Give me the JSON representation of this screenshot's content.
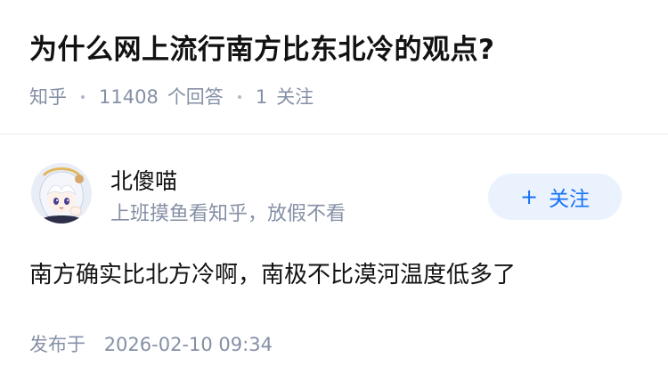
{
  "question": {
    "title": "为什么网上流行南方比东北冷的观点?",
    "meta": {
      "source": "知乎",
      "answer_count": "11408",
      "answer_label": "个回答",
      "follower_count": "1",
      "follower_label": "关注"
    }
  },
  "author": {
    "name": "北傻喵",
    "bio": "上班摸鱼看知乎，放假不看",
    "avatar_icon": "anime-avatar-icon",
    "follow_button": {
      "icon": "+",
      "label": "关注"
    }
  },
  "answer": {
    "content": "南方确实比北方冷啊，南极不比漠河温度低多了",
    "publish_label": "发布于",
    "publish_time": "2026-02-10 09:34"
  },
  "colors": {
    "title": "#121212",
    "meta": "#8590a6",
    "accent": "#1772f6",
    "follow_bg": "#eaf2fe",
    "divider": "#ebebeb"
  }
}
